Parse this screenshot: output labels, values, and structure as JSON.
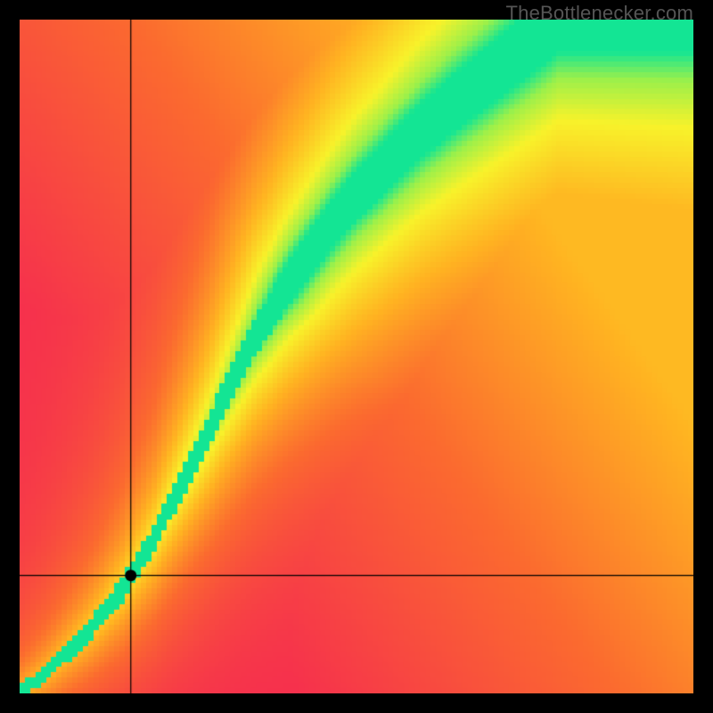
{
  "watermark": "TheBottlenecker.com",
  "chart_data": {
    "type": "heatmap",
    "title": "",
    "xlabel": "",
    "ylabel": "",
    "xlim": [
      0,
      1
    ],
    "ylim": [
      0,
      1
    ],
    "crosshair": {
      "x": 0.165,
      "y": 0.175
    },
    "marker": {
      "x": 0.165,
      "y": 0.175
    },
    "optimal_curve": {
      "description": "Green band center: y as a nonlinear increasing function of x; band widens with x.",
      "points": [
        {
          "x": 0.0,
          "y": 0.0
        },
        {
          "x": 0.05,
          "y": 0.04
        },
        {
          "x": 0.1,
          "y": 0.09
        },
        {
          "x": 0.15,
          "y": 0.15
        },
        {
          "x": 0.2,
          "y": 0.23
        },
        {
          "x": 0.25,
          "y": 0.33
        },
        {
          "x": 0.3,
          "y": 0.43
        },
        {
          "x": 0.35,
          "y": 0.53
        },
        {
          "x": 0.4,
          "y": 0.61
        },
        {
          "x": 0.45,
          "y": 0.68
        },
        {
          "x": 0.5,
          "y": 0.74
        },
        {
          "x": 0.55,
          "y": 0.79
        },
        {
          "x": 0.6,
          "y": 0.84
        },
        {
          "x": 0.65,
          "y": 0.88
        },
        {
          "x": 0.7,
          "y": 0.92
        },
        {
          "x": 0.75,
          "y": 0.96
        },
        {
          "x": 0.8,
          "y": 1.0
        }
      ],
      "band_halfwidth_at_x": [
        {
          "x": 0.0,
          "halfwidth": 0.01
        },
        {
          "x": 0.2,
          "halfwidth": 0.02
        },
        {
          "x": 0.4,
          "halfwidth": 0.032
        },
        {
          "x": 0.6,
          "halfwidth": 0.04
        },
        {
          "x": 0.8,
          "halfwidth": 0.048
        }
      ]
    },
    "colormap": {
      "description": "Value is match score 0..1: 0 red, mid orange/yellow, ~0.85 yellow-green, 1 cyan-green",
      "stops": [
        {
          "v": 0.0,
          "color": "#f52a50"
        },
        {
          "v": 0.35,
          "color": "#fb6a2f"
        },
        {
          "v": 0.6,
          "color": "#ffb321"
        },
        {
          "v": 0.8,
          "color": "#f8f22a"
        },
        {
          "v": 0.92,
          "color": "#9cf04a"
        },
        {
          "v": 1.0,
          "color": "#13e594"
        }
      ]
    },
    "resolution_hint": "pixelated ~128x128 cells"
  }
}
